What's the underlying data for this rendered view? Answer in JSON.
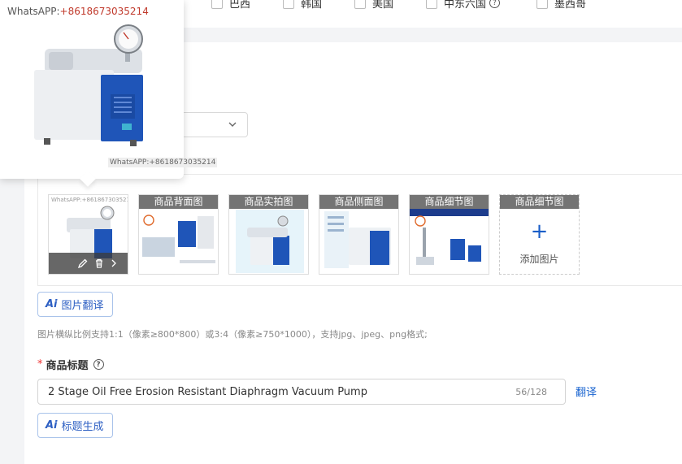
{
  "countries": [
    {
      "label": "巴西",
      "checked": false
    },
    {
      "label": "韩国",
      "checked": false
    },
    {
      "label": "美国",
      "checked": false
    },
    {
      "label": "中东六国",
      "checked": false,
      "help": true
    },
    {
      "label": "墨西哥",
      "checked": false
    }
  ],
  "popup": {
    "watermark_prefix": "WhatsAPP:",
    "watermark_number": "+8618673035214",
    "watermark_bottom": "WhatsAPP:+8618673035214"
  },
  "images": {
    "thumbs": [
      {
        "label": "",
        "watermark": "WhatsAPP:+8618673035214"
      },
      {
        "label": "商品背面图"
      },
      {
        "label": "商品实拍图"
      },
      {
        "label": "商品侧面图"
      },
      {
        "label": "商品细节图"
      }
    ],
    "add_slot_label": "商品细节图",
    "add_text": "添加图片",
    "add_icon": "+"
  },
  "buttons": {
    "ai_prefix": "Ai",
    "image_translate": "图片翻译",
    "title_generate": "标题生成"
  },
  "hint_text": "图片横纵比例支持1:1（像素≥800*800）或3:4（像素≥750*1000），支持jpg、jpeg、png格式;",
  "product_title": {
    "required_mark": "*",
    "label": "商品标题",
    "help_icon": "?",
    "value": "2 Stage Oil Free Erosion Resistant Diaphragm Vacuum Pump",
    "count": "56/128",
    "translate": "翻译"
  },
  "colors": {
    "accent": "#2d5fc3",
    "link": "#1a64d0",
    "pump_blue": "#1f55b8",
    "required": "#e33333"
  }
}
